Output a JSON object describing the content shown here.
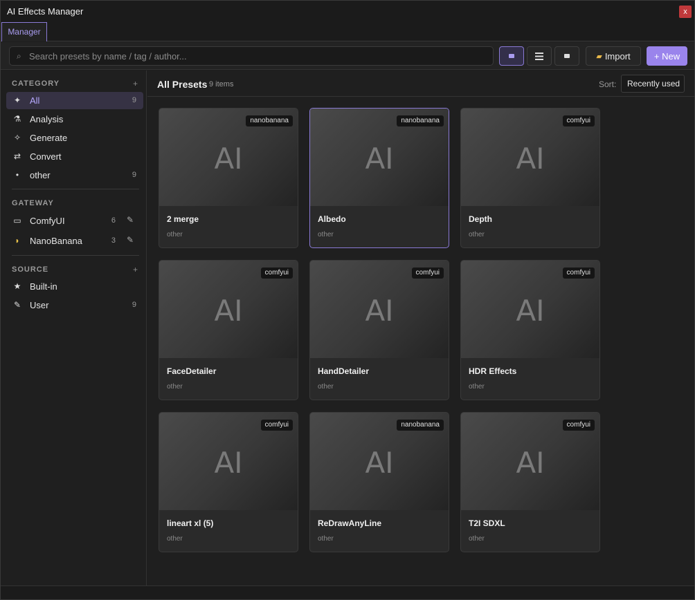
{
  "window": {
    "title": "AI Effects Manager",
    "close_label": "x"
  },
  "tabs": [
    {
      "label": "Manager"
    }
  ],
  "toolbar": {
    "search_placeholder": "Search presets by name / tag / author...",
    "import_label": "Import",
    "new_label": "+ New"
  },
  "sidebar": {
    "category_header": "CATEGORY",
    "gateway_header": "GATEWAY",
    "source_header": "SOURCE",
    "plus": "+",
    "categories": [
      {
        "label": "All",
        "count": "9",
        "icon": "sparkle-icon",
        "active": true
      },
      {
        "label": "Analysis",
        "count": "",
        "icon": "microscope-icon"
      },
      {
        "label": "Generate",
        "count": "",
        "icon": "star-outline-icon"
      },
      {
        "label": "Convert",
        "count": "",
        "icon": "swap-arrows-icon"
      },
      {
        "label": "other",
        "count": "9",
        "icon": "dot-icon"
      }
    ],
    "gateways": [
      {
        "label": "ComfyUI",
        "count": "6",
        "icon": "monitor-icon"
      },
      {
        "label": "NanoBanana",
        "count": "3",
        "icon": "banana-icon"
      }
    ],
    "sources": [
      {
        "label": "Built-in",
        "count": "",
        "icon": "star-icon"
      },
      {
        "label": "User",
        "count": "9",
        "icon": "pencil-icon"
      }
    ]
  },
  "main": {
    "title": "All Presets",
    "count_label": "9 items",
    "sort_label": "Sort:",
    "sort_value": "Recently used"
  },
  "presets": [
    {
      "name": "2 merge",
      "category": "other",
      "gateway": "nanobanana",
      "thumb_text": "AI"
    },
    {
      "name": "Albedo",
      "category": "other",
      "gateway": "nanobanana",
      "thumb_text": "AI",
      "selected": true
    },
    {
      "name": "Depth",
      "category": "other",
      "gateway": "comfyui",
      "thumb_text": "AI"
    },
    {
      "name": "FaceDetailer",
      "category": "other",
      "gateway": "comfyui",
      "thumb_text": "AI"
    },
    {
      "name": "HandDetailer",
      "category": "other",
      "gateway": "comfyui",
      "thumb_text": "AI"
    },
    {
      "name": "HDR Effects",
      "category": "other",
      "gateway": "comfyui",
      "thumb_text": "AI"
    },
    {
      "name": "lineart xl (5)",
      "category": "other",
      "gateway": "comfyui",
      "thumb_text": "AI"
    },
    {
      "name": "ReDrawAnyLine",
      "category": "other",
      "gateway": "nanobanana",
      "thumb_text": "AI"
    },
    {
      "name": "T2I SDXL",
      "category": "other",
      "gateway": "comfyui",
      "thumb_text": "AI"
    }
  ],
  "colors": {
    "accent": "#9a84ec",
    "close": "#c0393b"
  }
}
